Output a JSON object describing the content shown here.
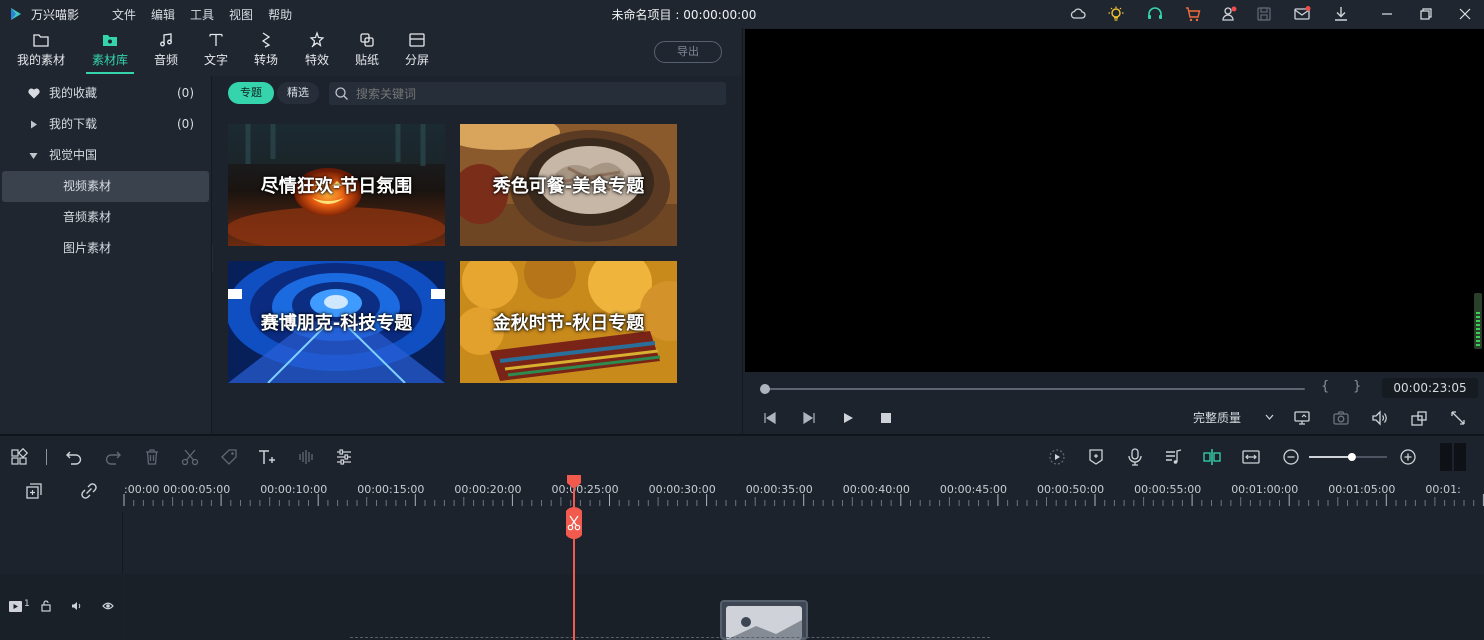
{
  "app": {
    "name": "万兴喵影",
    "project_title": "未命名项目 : 00:00:00:00",
    "menu": [
      "文件",
      "编辑",
      "工具",
      "视图",
      "帮助"
    ],
    "title_icons": [
      "cloud-icon",
      "lightbulb-icon",
      "headset-icon",
      "cart-icon",
      "account-icon",
      "save-icon",
      "mail-icon",
      "download-icon",
      "minimize-icon",
      "restore-icon",
      "close-icon"
    ],
    "accent_color": "#35d4ad"
  },
  "toolbar": {
    "tabs": [
      {
        "label": "我的素材",
        "icon": "folder-icon"
      },
      {
        "label": "素材库",
        "icon": "library-folder-icon",
        "active": true
      },
      {
        "label": "音频",
        "icon": "music-note-icon"
      },
      {
        "label": "文字",
        "icon": "text-icon"
      },
      {
        "label": "转场",
        "icon": "transition-icon"
      },
      {
        "label": "特效",
        "icon": "effects-icon"
      },
      {
        "label": "贴纸",
        "icon": "sticker-icon"
      },
      {
        "label": "分屏",
        "icon": "split-screen-icon"
      }
    ],
    "export_label": "导出"
  },
  "sidebar": {
    "items": [
      {
        "label": "我的收藏",
        "count": "(0)",
        "icon": "heart-icon"
      },
      {
        "label": "我的下载",
        "count": "(0)",
        "icon": "caret-right-icon"
      },
      {
        "label": "视觉中国",
        "count": "",
        "icon": "caret-down-icon"
      },
      {
        "label": "视频素材",
        "count": "",
        "selected": true
      },
      {
        "label": "音频素材",
        "count": ""
      },
      {
        "label": "图片素材",
        "count": ""
      }
    ]
  },
  "library": {
    "chips": [
      "专题",
      "精选"
    ],
    "search_placeholder": "搜索关键词",
    "cards": [
      {
        "caption": "尽情狂欢-节日氛围"
      },
      {
        "caption": "秀色可餐-美食专题"
      },
      {
        "caption": "赛博朋克-科技专题"
      },
      {
        "caption": "金秋时节-秋日专题"
      }
    ]
  },
  "preview": {
    "timecode": "00:00:23:05",
    "mark_in": "{",
    "mark_out": "}",
    "quality": "完整质量",
    "progress": 0.0
  },
  "timeline": {
    "ticks": [
      ":00:00",
      "00:00:05:00",
      "00:00:10:00",
      "00:00:15:00",
      "00:00:20:00",
      "00:00:25:00",
      "00:00:30:00",
      "00:00:35:00",
      "00:00:40:00",
      "00:00:45:00",
      "00:00:50:00",
      "00:00:55:00",
      "00:01:00:00",
      "00:01:05:00",
      "00:01:"
    ],
    "playhead_time": "00:00:23:05",
    "track_number": "1",
    "zoom_level": 0.55
  }
}
